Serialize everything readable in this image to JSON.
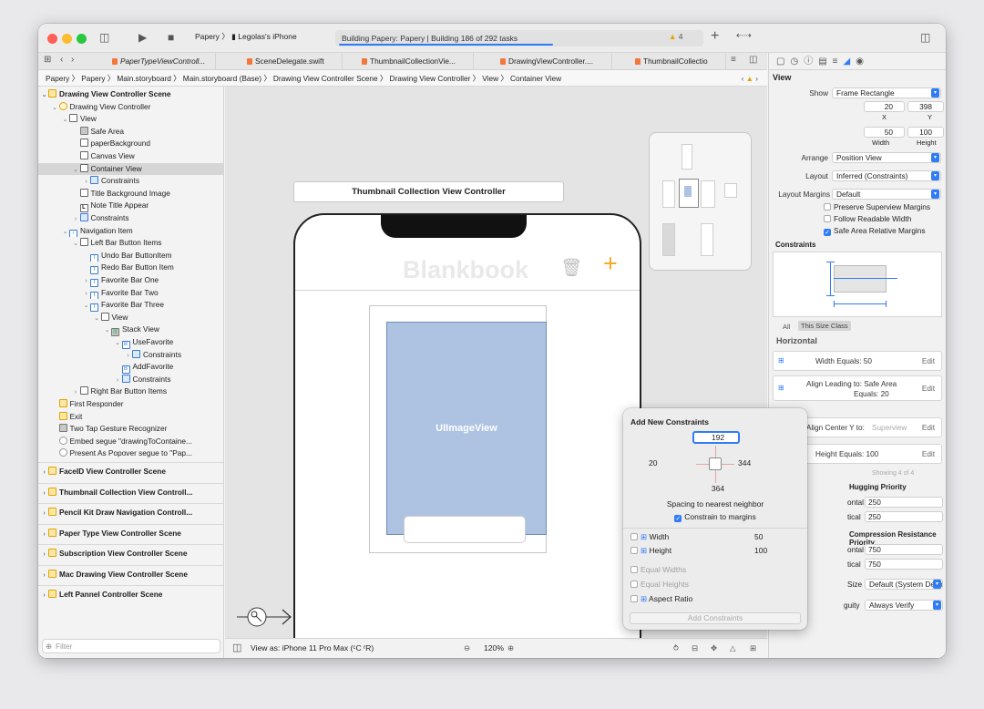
{
  "toolbar": {
    "scheme": "Papery",
    "device": "Legolas's iPhone",
    "status": "Building Papery: Papery | Building 186 of 292 tasks",
    "warnings": "4",
    "add": "+",
    "lr": "⇠⇢"
  },
  "tabs": [
    "PaperTypeViewControll...",
    "SceneDelegate.swift",
    "ThumbnailCollectionVie...",
    "DrawingViewController....",
    "ThumbnailCollectio"
  ],
  "jumpbar": "Papery 〉 Papery 〉 Main.storyboard 〉 Main.storyboard (Base) 〉 Drawing View Controller Scene 〉 Drawing View Controller 〉 View 〉 Container View",
  "outline": [
    {
      "t": "Drawing View Controller Scene",
      "lv": 0,
      "d": "⌄",
      "ic": "scene",
      "b": true
    },
    {
      "t": "Drawing View Controller",
      "lv": 1,
      "d": "⌄",
      "ic": "ctrl"
    },
    {
      "t": "View",
      "lv": 2,
      "d": "⌄",
      "ic": "view"
    },
    {
      "t": "Safe Area",
      "lv": 3,
      "d": "",
      "ic": "sv"
    },
    {
      "t": "paperBackground",
      "lv": 3,
      "d": "",
      "ic": "view"
    },
    {
      "t": "Canvas View",
      "lv": 3,
      "d": "",
      "ic": "view"
    },
    {
      "t": "Container View",
      "lv": 3,
      "d": "⌄",
      "ic": "view",
      "sel": true
    },
    {
      "t": "Constraints",
      "lv": 4,
      "d": "›",
      "ic": "cons"
    },
    {
      "t": "Title Background Image",
      "lv": 3,
      "d": "",
      "ic": "view"
    },
    {
      "t": "Note Title Appear",
      "lv": 3,
      "d": "",
      "ic": "lbl",
      "g": "L"
    },
    {
      "t": "Constraints",
      "lv": 3,
      "d": "›",
      "ic": "cons"
    },
    {
      "t": "Navigation Item",
      "lv": 2,
      "d": "⌄",
      "ic": "bb",
      "g": "‹"
    },
    {
      "t": "Left Bar Button Items",
      "lv": 3,
      "d": "⌄",
      "ic": "view"
    },
    {
      "t": "Undo Bar ButtonItem",
      "lv": 4,
      "d": "",
      "ic": "bb",
      "g": "I"
    },
    {
      "t": "Redo Bar Button Item",
      "lv": 4,
      "d": "",
      "ic": "bb",
      "g": "I"
    },
    {
      "t": "Favorite Bar One",
      "lv": 4,
      "d": "›",
      "ic": "bb",
      "g": "I"
    },
    {
      "t": "Favorite Bar Two",
      "lv": 4,
      "d": "›",
      "ic": "bb",
      "g": "I"
    },
    {
      "t": "Favorite Bar Three",
      "lv": 4,
      "d": "⌄",
      "ic": "bb",
      "g": "I"
    },
    {
      "t": "View",
      "lv": 5,
      "d": "⌄",
      "ic": "view"
    },
    {
      "t": "Stack View",
      "lv": 6,
      "d": "⌄",
      "ic": "sv",
      "g": "|||"
    },
    {
      "t": "UseFavorite",
      "lv": 7,
      "d": "⌄",
      "ic": "bb",
      "g": "B"
    },
    {
      "t": "Constraints",
      "lv": 8,
      "d": "›",
      "ic": "cons"
    },
    {
      "t": "AddFavorite",
      "lv": 7,
      "d": "",
      "ic": "bb",
      "g": "B"
    },
    {
      "t": "Constraints",
      "lv": 7,
      "d": "›",
      "ic": "cons"
    },
    {
      "t": "Right Bar Button Items",
      "lv": 3,
      "d": "›",
      "ic": "view"
    },
    {
      "t": "First Responder",
      "lv": 1,
      "d": "",
      "ic": "scene"
    },
    {
      "t": "Exit",
      "lv": 1,
      "d": "",
      "ic": "scene"
    },
    {
      "t": "Two Tap Gesture Recognizer",
      "lv": 1,
      "d": "",
      "ic": "sv"
    },
    {
      "t": "Embed segue \"drawingToContaine...",
      "lv": 1,
      "d": "",
      "ic": "seg"
    },
    {
      "t": "Present As Popover segue to \"Pap...",
      "lv": 1,
      "d": "",
      "ic": "seg"
    }
  ],
  "scenes": [
    "FaceID View Controller Scene",
    "Thumbnail Collection View Controll...",
    "Pencil Kit Draw Navigation Controll...",
    "Paper Type View Controller Scene",
    "Subscription View Controller Scene",
    "Mac Drawing View Controller Scene",
    "Left Pannel Controller Scene"
  ],
  "filter": "Filter",
  "canvas": {
    "header": "Thumbnail Collection View Controller",
    "app_title": "Blankbook",
    "image_view": "UIImageView",
    "view_as": "View as: iPhone 11 Pro Max (ᶜC ʳR)",
    "zoom": "120%"
  },
  "inspector": {
    "section": "View",
    "show_label": "Show",
    "show": "Frame Rectangle",
    "x": "20",
    "y": "398",
    "x_label": "X",
    "y_label": "Y",
    "w": "50",
    "h": "100",
    "w_label": "Width",
    "h_label": "Height",
    "arrange_label": "Arrange",
    "arrange": "Position View",
    "layout_label": "Layout",
    "layout": "Inferred (Constraints)",
    "margins_label": "Layout Margins",
    "margins": "Default",
    "preserve": "Preserve Superview Margins",
    "readable": "Follow Readable Width",
    "safearea": "Safe Area Relative Margins",
    "constraints_title": "Constraints",
    "all": "All",
    "size_class": "This Size Class",
    "horizontal": "Horizontal",
    "c1": "Width Equals: 50",
    "c2a": "Align Leading to: Safe Area",
    "c2b": "Equals: 20",
    "c3": "Align Center Y to:",
    "c3b": "Superview",
    "c4": "Height Equals: 100",
    "showing": "Showing 4 of 4",
    "edit": "Edit",
    "hug": "Hugging Priority",
    "hug_h": "250",
    "hug_v": "250",
    "ontal": "ontal",
    "tical": "tical",
    "comp": "Compression Resistance Priority",
    "comp_h": "750",
    "comp_v": "750",
    "size_label": "Size",
    "size": "Default (System Defined)",
    "amb_label": "guity",
    "amb": "Always Verify"
  },
  "popover": {
    "title": "Add New Constraints",
    "top": "192",
    "left": "20",
    "right": "344",
    "bottom": "364",
    "spacing": "Spacing to nearest neighbor",
    "constrain": "Constrain to margins",
    "width_label": "Width",
    "width": "50",
    "height_label": "Height",
    "height": "100",
    "eq_w": "Equal Widths",
    "eq_h": "Equal Heights",
    "aspect": "Aspect Ratio",
    "add": "Add Constraints"
  }
}
